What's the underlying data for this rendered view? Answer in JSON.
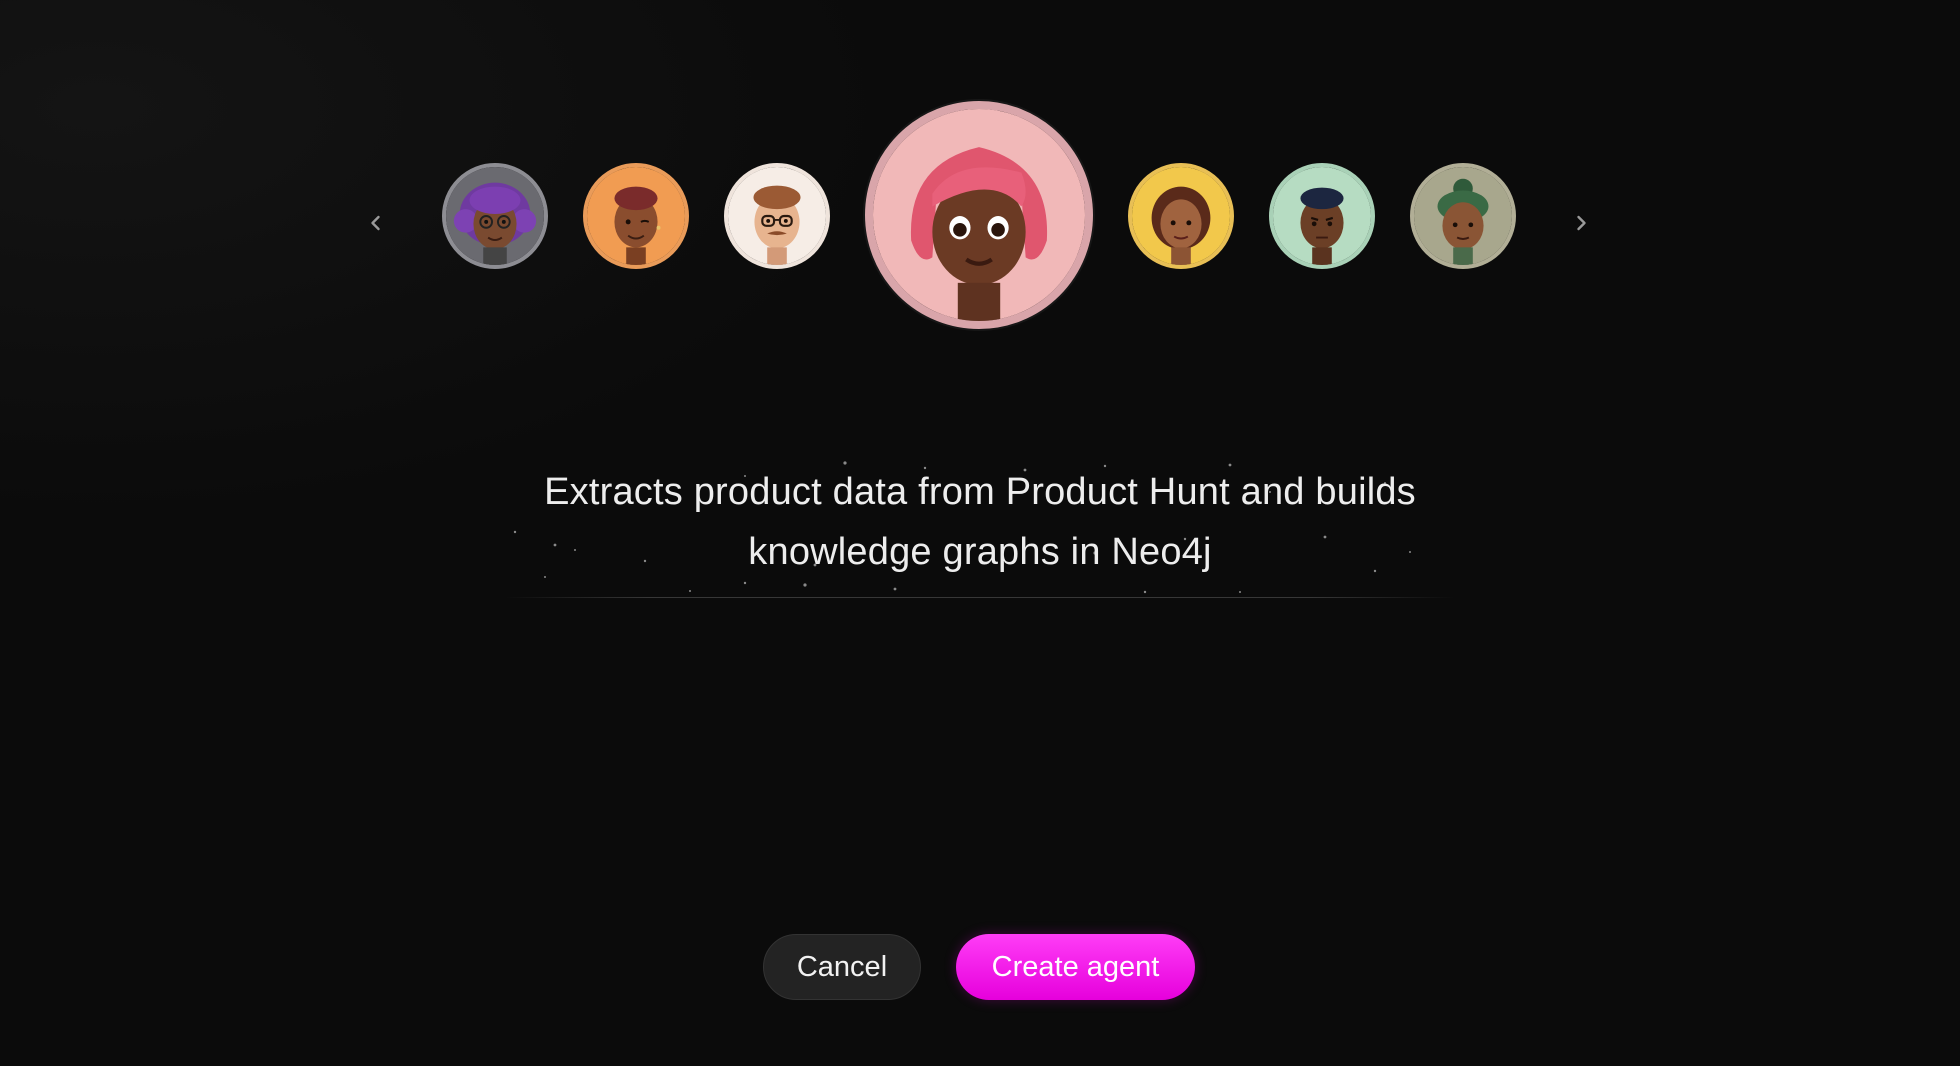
{
  "carousel": {
    "prev_icon": "chevron-left-icon",
    "next_icon": "chevron-right-icon",
    "avatars": [
      {
        "name": "avatar-purple-hair-glasses",
        "bg": "#6b6b70"
      },
      {
        "name": "avatar-orange-winking",
        "bg": "#f1a15b"
      },
      {
        "name": "avatar-glasses-mustache",
        "bg": "#f6eee8"
      },
      {
        "name": "avatar-pink-hair-selected",
        "bg": "#f1b7b7",
        "selected": true
      },
      {
        "name": "avatar-yellow-woman",
        "bg": "#f2c84b"
      },
      {
        "name": "avatar-green-man",
        "bg": "#b4dcc0"
      },
      {
        "name": "avatar-sage-braids",
        "bg": "#a9a88e"
      }
    ]
  },
  "agent": {
    "description": "Extracts product data from Product Hunt and builds knowledge graphs in Neo4j"
  },
  "actions": {
    "cancel_label": "Cancel",
    "create_label": "Create agent"
  },
  "colors": {
    "background": "#0b0b0b",
    "accent": "#f20aea",
    "cancel_bg": "#232323"
  }
}
